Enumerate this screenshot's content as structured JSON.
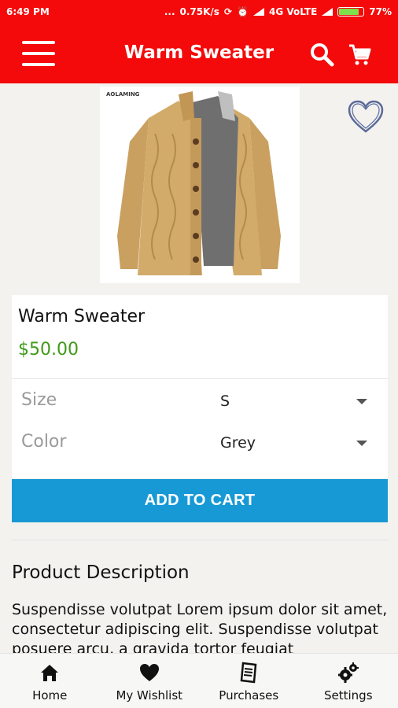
{
  "status_bar": {
    "time": "6:49 PM",
    "dots": "...",
    "network_speed": "0.75K/s",
    "network_type": "4G VoLTE",
    "battery": "77%",
    "battery_level": 0.77
  },
  "app_bar": {
    "title": "Warm Sweater",
    "menu_icon": "hamburger-menu-icon",
    "search_icon": "search-icon",
    "cart_icon": "cart-icon"
  },
  "product": {
    "brand": "AOLAMING",
    "name": "Warm Sweater",
    "price": "$50.00",
    "wishlist_icon": "heart-outline-icon"
  },
  "options": {
    "size_label": "Size",
    "size_value": "S",
    "color_label": "Color",
    "color_value": "Grey"
  },
  "actions": {
    "add_to_cart": "ADD TO CART"
  },
  "description": {
    "title": "Product Description",
    "text": "Suspendisse volutpat Lorem ipsum dolor sit amet, consectetur adipiscing elit. Suspendisse volutpat posuere arcu, a gravida tortor feugiat"
  },
  "bottom_nav": {
    "items": [
      {
        "label": "Home",
        "icon": "home-icon"
      },
      {
        "label": "My Wishlist",
        "icon": "heart-icon"
      },
      {
        "label": "Purchases",
        "icon": "receipt-icon"
      },
      {
        "label": "Settings",
        "icon": "gears-icon"
      }
    ]
  },
  "colors": {
    "primary": "#f40a0a",
    "accent": "#1799d6",
    "price": "#3f9a18"
  }
}
